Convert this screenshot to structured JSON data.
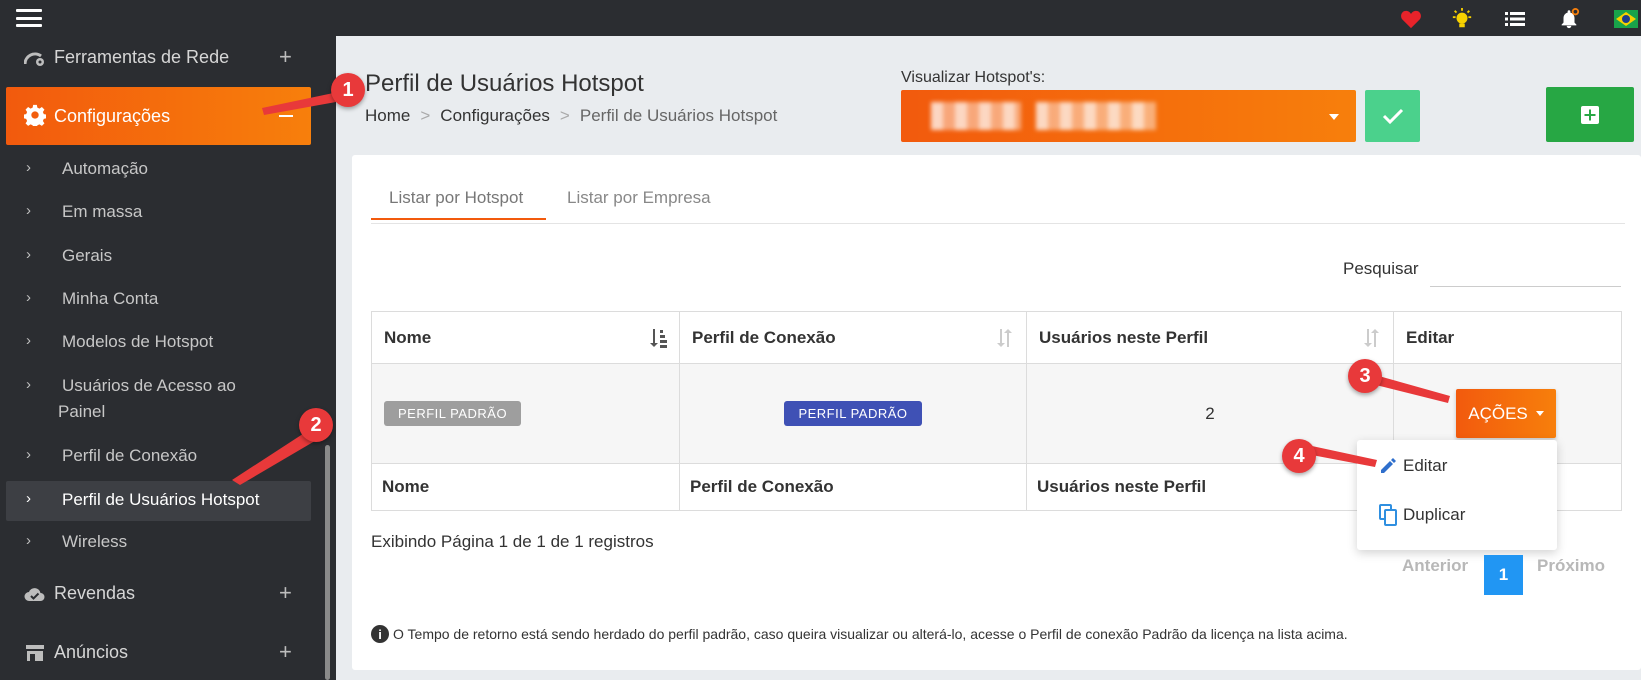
{
  "topbar": {
    "icons": [
      "heart-icon",
      "lightbulb-icon",
      "list-icon",
      "bell-icon",
      "brazil-flag-icon"
    ]
  },
  "sidebar": {
    "sections": [
      {
        "label": "Ferramentas de Rede",
        "icon": "network-gear-icon"
      },
      {
        "label": "Configurações",
        "icon": "gear-icon",
        "active": true
      },
      {
        "label": "Revendas",
        "icon": "cloud-check-icon"
      },
      {
        "label": "Anúncios",
        "icon": "store-icon"
      }
    ],
    "sub_items": [
      {
        "label": "Automação"
      },
      {
        "label": "Em massa"
      },
      {
        "label": "Gerais"
      },
      {
        "label": "Minha Conta"
      },
      {
        "label": "Modelos de Hotspot"
      },
      {
        "label": "Usuários de Acesso ao",
        "label2": "Painel"
      },
      {
        "label": "Perfil de Conexão"
      },
      {
        "label": "Perfil de Usuários Hotspot",
        "selected": true
      },
      {
        "label": "Wireless"
      }
    ]
  },
  "header": {
    "title": "Perfil de Usuários Hotspot",
    "breadcrumb": [
      "Home",
      "Configurações",
      "Perfil de Usuários Hotspot"
    ],
    "breadcrumb_sep": ">",
    "hotspot_label": "Visualizar Hotspot's:"
  },
  "tabs": [
    {
      "label": "Listar por Hotspot",
      "active": true
    },
    {
      "label": "Listar por Empresa"
    }
  ],
  "search": {
    "label": "Pesquisar"
  },
  "table": {
    "headers": [
      "Nome",
      "Perfil de Conexão",
      "Usuários neste Perfil",
      "Editar"
    ],
    "footer": [
      "Nome",
      "Perfil de Conexão",
      "Usuários neste Perfil"
    ],
    "rows": [
      {
        "nome": "PERFIL PADRÃO",
        "perfil": "PERFIL PADRÃO",
        "usuarios": "2"
      }
    ]
  },
  "actions": {
    "button": "AÇÕES",
    "items": [
      {
        "label": "Editar",
        "icon": "pencil-icon"
      },
      {
        "label": "Duplicar",
        "icon": "copy-icon"
      }
    ]
  },
  "pagination": {
    "info": "Exibindo Página 1 de 1 de 1 registros",
    "prev": "Anterior",
    "current": "1",
    "next": "Próximo"
  },
  "footnote": "O Tempo de retorno está sendo herdado do perfil padrão, caso queira visualizar ou alterá-lo, acesse o Perfil de conexão Padrão da licença na lista acima.",
  "annotations": [
    "1",
    "2",
    "3",
    "4"
  ],
  "colors": {
    "accent": "#f25a0d",
    "success": "#27a744",
    "check": "#4bd18c",
    "badge_blue": "#3f51b5",
    "badge_grey": "#9e9e9e",
    "pager_active": "#2196f3",
    "marker": "#e8393a"
  }
}
